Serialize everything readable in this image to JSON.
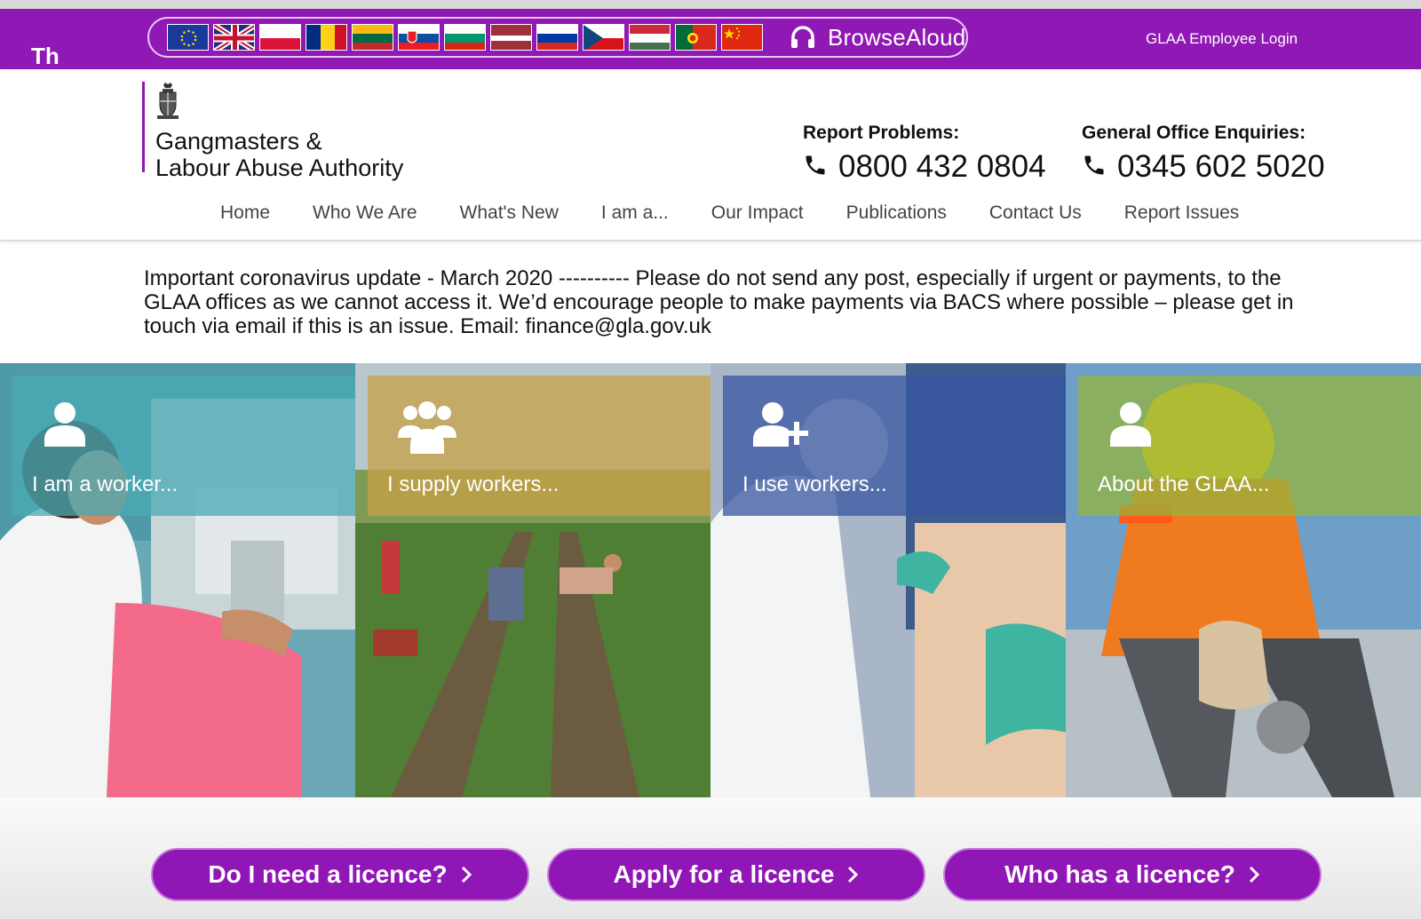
{
  "topbar": {
    "partial_text": "Th",
    "browsealoud_label": "BrowseAloud",
    "employee_login": "GLAA Employee Login",
    "flags": [
      "eu-flag",
      "uk-flag",
      "poland-flag",
      "romania-flag",
      "lithuania-flag",
      "slovakia-flag",
      "bulgaria-flag",
      "latvia-flag",
      "russia-flag",
      "czech-flag",
      "hungary-flag",
      "portugal-flag",
      "china-flag"
    ]
  },
  "header": {
    "logo_line1": "Gangmasters &",
    "logo_line2": "Labour Abuse Authority",
    "report": {
      "label": "Report Problems:",
      "number": "0800 432 0804"
    },
    "office": {
      "label": "General Office Enquiries:",
      "number": "0345 602 5020"
    }
  },
  "nav": [
    "Home",
    "Who We Are",
    "What's New",
    "I am a...",
    "Our Impact",
    "Publications",
    "Contact Us",
    "Report Issues"
  ],
  "notice": "Important coronavirus update - March 2020 ---------- Please do not send any post, especially if urgent or payments, to the GLAA offices as we cannot access it. We’d encourage people to make payments via BACS where possible – please get in touch via email if this is an issue. Email: finance@gla.gov.uk",
  "tiles": [
    {
      "label": "I am a worker...",
      "icon": "user-icon"
    },
    {
      "label": "I supply workers...",
      "icon": "group-icon"
    },
    {
      "label": "I use workers...",
      "icon": "user-plus-icon"
    },
    {
      "label": "About the GLAA...",
      "icon": "user-icon"
    }
  ],
  "licence_buttons": [
    "Do I need a licence?",
    "Apply for a licence",
    "Who has a licence?"
  ],
  "colors": {
    "brand_purple": "#9018b4",
    "button_purple": "#9016b6"
  }
}
